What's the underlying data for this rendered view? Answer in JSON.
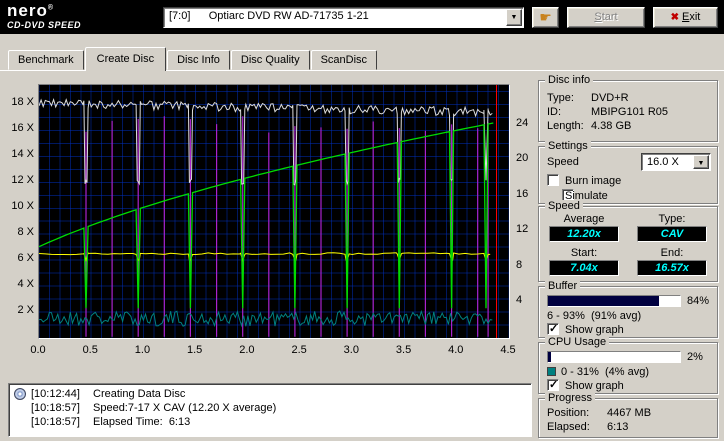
{
  "header": {
    "logo_title": "nero",
    "logo_reg": "®",
    "logo_subtitle": "CD-DVD SPEED",
    "drive": "[7:0]      Optiarc DVD RW AD-71735 1-21",
    "start_label": "Start",
    "exit_label": "Exit"
  },
  "tabs": [
    {
      "label": "Benchmark"
    },
    {
      "label": "Create Disc"
    },
    {
      "label": "Disc Info"
    },
    {
      "label": "Disc Quality"
    },
    {
      "label": "ScanDisc"
    }
  ],
  "disc_info": {
    "title": "Disc info",
    "type_label": "Type:",
    "type_value": "DVD+R",
    "id_label": "ID:",
    "id_value": "MBIPG101 R05",
    "length_label": "Length:",
    "length_value": "4.38 GB"
  },
  "settings": {
    "title": "Settings",
    "speed_label": "Speed",
    "speed_value": "16.0 X",
    "burn_image_label": "Burn image",
    "burn_image_checked": false,
    "simulate_label": "Simulate",
    "simulate_checked": false
  },
  "speed": {
    "title": "Speed",
    "average_label": "Average",
    "average_value": "12.20x",
    "type_label": "Type:",
    "type_value": "CAV",
    "start_label": "Start:",
    "start_value": "7.04x",
    "end_label": "End:",
    "end_value": "16.57x",
    "lcd_color": "#00ffff"
  },
  "buffer": {
    "title": "Buffer",
    "percent_label": "84%",
    "percent_value": 84,
    "bar_color": "#000040",
    "range_text": "6 - 93%  (91% avg)",
    "show_graph_label": "Show graph",
    "show_graph_checked": true
  },
  "cpu": {
    "title": "CPU Usage",
    "percent_label": "2%",
    "percent_value": 2,
    "bar_color": "#000040",
    "swatch_color": "#008080",
    "range_text": "0 - 31%  (4% avg)",
    "show_graph_label": "Show graph",
    "show_graph_checked": true
  },
  "progress": {
    "title": "Progress",
    "position_label": "Position:",
    "position_value": "4467 MB",
    "elapsed_label": "Elapsed:",
    "elapsed_value": "6:13"
  },
  "log": {
    "lines": [
      {
        "time": "[10:12:44]",
        "text": "Creating Data Disc"
      },
      {
        "time": "[10:18:57]",
        "text": "Speed:7-17 X CAV (12.20 X average)"
      },
      {
        "time": "[10:18:57]",
        "text": "Elapsed Time:  6:13"
      }
    ]
  },
  "chart_data": {
    "type": "line",
    "title": "Create Disc write speed graph",
    "x_axis": {
      "min": 0,
      "max": 4.5,
      "unit": "GB",
      "ticks": [
        0,
        0.5,
        1,
        1.5,
        2,
        2.5,
        3,
        3.5,
        4,
        4.5
      ]
    },
    "y_left_axis": {
      "min": 0,
      "max": 19.5,
      "suffix": " X",
      "ticks": [
        18,
        16,
        14,
        12,
        10,
        8,
        6,
        4,
        2
      ]
    },
    "y_right_axis": {
      "min": 0,
      "max": 28.5,
      "ticks": [
        24,
        20,
        16,
        12,
        8,
        4
      ]
    },
    "grid": {
      "color": "#0030c0",
      "x_step": 0.1,
      "y_step": 1
    },
    "series": {
      "write_speed": {
        "color": "#00dc00",
        "mode": "CAV",
        "start_speed": 7.04,
        "end_speed": 16.57,
        "x_end": 4.35,
        "dip_positions": [
          0.45,
          0.95,
          1.45,
          1.95,
          2.45,
          2.95,
          3.45,
          3.95,
          4.28
        ],
        "dip_value": 2.3
      },
      "baseline": {
        "color": "#ffff00",
        "level": 6.5,
        "dip_value": 6.0,
        "x_end": 4.35
      },
      "top_line": {
        "color": "#dcdcdc",
        "level_start": 18.1,
        "level_end": 17.4,
        "noise": 0.35,
        "dip_value": 11.8,
        "x_end": 4.35
      },
      "cpu_line": {
        "color": "#008080",
        "level": 1.5,
        "noise": 0.6,
        "x_end": 4.35
      }
    },
    "spike_lines": {
      "color": "#aa22cc",
      "top": 17.2,
      "positions": [
        0.45,
        0.7,
        0.95,
        1.2,
        1.45,
        1.7,
        1.95,
        2.2,
        2.45,
        2.7,
        2.95,
        3.2,
        3.45,
        3.7,
        3.95,
        4.2,
        4.3
      ]
    },
    "end_line": {
      "color": "#ff0000",
      "x": 4.38
    }
  }
}
